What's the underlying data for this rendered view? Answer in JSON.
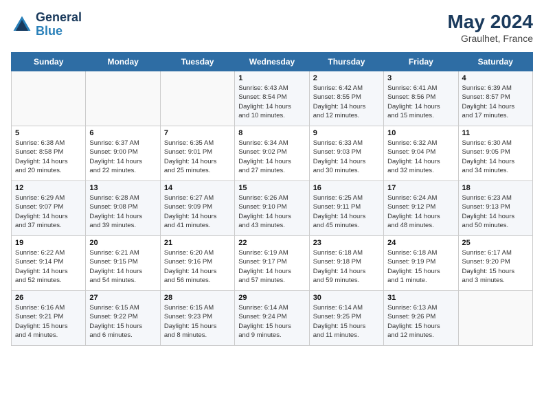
{
  "header": {
    "logo_line1": "General",
    "logo_line2": "Blue",
    "month_year": "May 2024",
    "location": "Graulhet, France"
  },
  "days_of_week": [
    "Sunday",
    "Monday",
    "Tuesday",
    "Wednesday",
    "Thursday",
    "Friday",
    "Saturday"
  ],
  "weeks": [
    [
      {
        "day": "",
        "info": ""
      },
      {
        "day": "",
        "info": ""
      },
      {
        "day": "",
        "info": ""
      },
      {
        "day": "1",
        "info": "Sunrise: 6:43 AM\nSunset: 8:54 PM\nDaylight: 14 hours\nand 10 minutes."
      },
      {
        "day": "2",
        "info": "Sunrise: 6:42 AM\nSunset: 8:55 PM\nDaylight: 14 hours\nand 12 minutes."
      },
      {
        "day": "3",
        "info": "Sunrise: 6:41 AM\nSunset: 8:56 PM\nDaylight: 14 hours\nand 15 minutes."
      },
      {
        "day": "4",
        "info": "Sunrise: 6:39 AM\nSunset: 8:57 PM\nDaylight: 14 hours\nand 17 minutes."
      }
    ],
    [
      {
        "day": "5",
        "info": "Sunrise: 6:38 AM\nSunset: 8:58 PM\nDaylight: 14 hours\nand 20 minutes."
      },
      {
        "day": "6",
        "info": "Sunrise: 6:37 AM\nSunset: 9:00 PM\nDaylight: 14 hours\nand 22 minutes."
      },
      {
        "day": "7",
        "info": "Sunrise: 6:35 AM\nSunset: 9:01 PM\nDaylight: 14 hours\nand 25 minutes."
      },
      {
        "day": "8",
        "info": "Sunrise: 6:34 AM\nSunset: 9:02 PM\nDaylight: 14 hours\nand 27 minutes."
      },
      {
        "day": "9",
        "info": "Sunrise: 6:33 AM\nSunset: 9:03 PM\nDaylight: 14 hours\nand 30 minutes."
      },
      {
        "day": "10",
        "info": "Sunrise: 6:32 AM\nSunset: 9:04 PM\nDaylight: 14 hours\nand 32 minutes."
      },
      {
        "day": "11",
        "info": "Sunrise: 6:30 AM\nSunset: 9:05 PM\nDaylight: 14 hours\nand 34 minutes."
      }
    ],
    [
      {
        "day": "12",
        "info": "Sunrise: 6:29 AM\nSunset: 9:07 PM\nDaylight: 14 hours\nand 37 minutes."
      },
      {
        "day": "13",
        "info": "Sunrise: 6:28 AM\nSunset: 9:08 PM\nDaylight: 14 hours\nand 39 minutes."
      },
      {
        "day": "14",
        "info": "Sunrise: 6:27 AM\nSunset: 9:09 PM\nDaylight: 14 hours\nand 41 minutes."
      },
      {
        "day": "15",
        "info": "Sunrise: 6:26 AM\nSunset: 9:10 PM\nDaylight: 14 hours\nand 43 minutes."
      },
      {
        "day": "16",
        "info": "Sunrise: 6:25 AM\nSunset: 9:11 PM\nDaylight: 14 hours\nand 45 minutes."
      },
      {
        "day": "17",
        "info": "Sunrise: 6:24 AM\nSunset: 9:12 PM\nDaylight: 14 hours\nand 48 minutes."
      },
      {
        "day": "18",
        "info": "Sunrise: 6:23 AM\nSunset: 9:13 PM\nDaylight: 14 hours\nand 50 minutes."
      }
    ],
    [
      {
        "day": "19",
        "info": "Sunrise: 6:22 AM\nSunset: 9:14 PM\nDaylight: 14 hours\nand 52 minutes."
      },
      {
        "day": "20",
        "info": "Sunrise: 6:21 AM\nSunset: 9:15 PM\nDaylight: 14 hours\nand 54 minutes."
      },
      {
        "day": "21",
        "info": "Sunrise: 6:20 AM\nSunset: 9:16 PM\nDaylight: 14 hours\nand 56 minutes."
      },
      {
        "day": "22",
        "info": "Sunrise: 6:19 AM\nSunset: 9:17 PM\nDaylight: 14 hours\nand 57 minutes."
      },
      {
        "day": "23",
        "info": "Sunrise: 6:18 AM\nSunset: 9:18 PM\nDaylight: 14 hours\nand 59 minutes."
      },
      {
        "day": "24",
        "info": "Sunrise: 6:18 AM\nSunset: 9:19 PM\nDaylight: 15 hours\nand 1 minute."
      },
      {
        "day": "25",
        "info": "Sunrise: 6:17 AM\nSunset: 9:20 PM\nDaylight: 15 hours\nand 3 minutes."
      }
    ],
    [
      {
        "day": "26",
        "info": "Sunrise: 6:16 AM\nSunset: 9:21 PM\nDaylight: 15 hours\nand 4 minutes."
      },
      {
        "day": "27",
        "info": "Sunrise: 6:15 AM\nSunset: 9:22 PM\nDaylight: 15 hours\nand 6 minutes."
      },
      {
        "day": "28",
        "info": "Sunrise: 6:15 AM\nSunset: 9:23 PM\nDaylight: 15 hours\nand 8 minutes."
      },
      {
        "day": "29",
        "info": "Sunrise: 6:14 AM\nSunset: 9:24 PM\nDaylight: 15 hours\nand 9 minutes."
      },
      {
        "day": "30",
        "info": "Sunrise: 6:14 AM\nSunset: 9:25 PM\nDaylight: 15 hours\nand 11 minutes."
      },
      {
        "day": "31",
        "info": "Sunrise: 6:13 AM\nSunset: 9:26 PM\nDaylight: 15 hours\nand 12 minutes."
      },
      {
        "day": "",
        "info": ""
      }
    ]
  ]
}
